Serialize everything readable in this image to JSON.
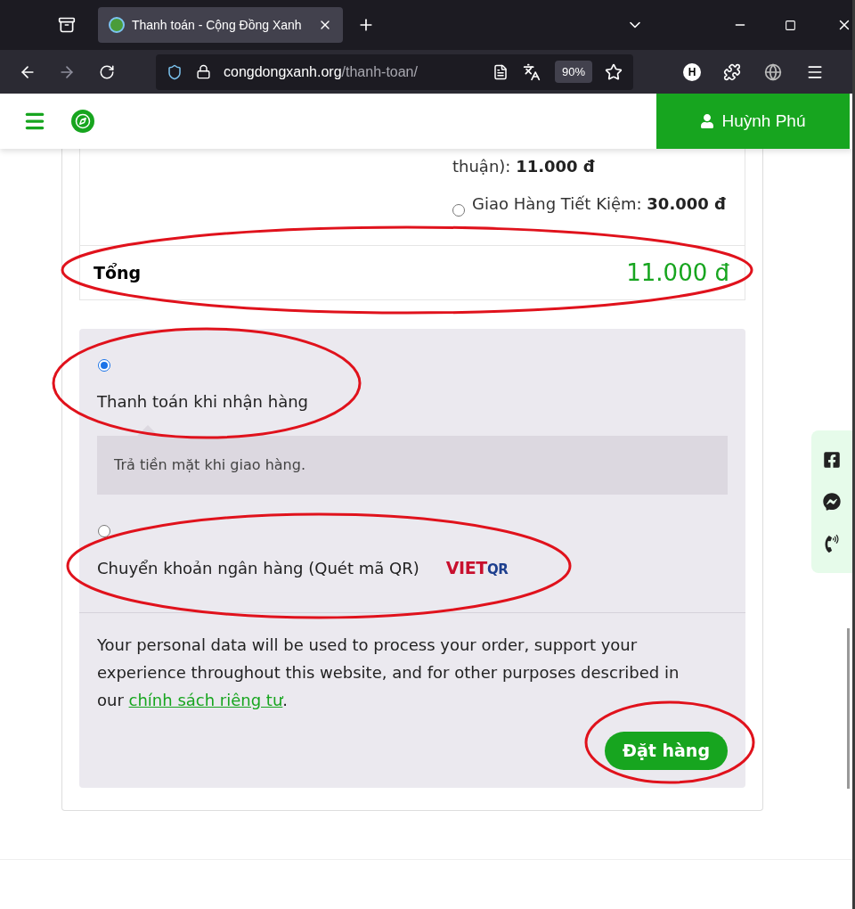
{
  "browser": {
    "tab_title": "Thanh toán - Cộng Đồng Xanh",
    "url_host": "congdongxanh.org",
    "url_path": "/thanh-toan/",
    "zoom": "90%",
    "profile_initial": "H"
  },
  "header": {
    "user_name": "Huỳnh Phú"
  },
  "shipping_options": [
    {
      "label": "thuận):",
      "price": "11.000 đ"
    },
    {
      "label": "Giao Hàng Tiết Kiệm:",
      "price": "30.000 đ",
      "selected": false
    }
  ],
  "total": {
    "label": "Tổng",
    "value": "11.000 đ"
  },
  "payment_methods": [
    {
      "label": "Thanh toán khi nhận hàng",
      "selected": true,
      "description": "Trả tiền mặt khi giao hàng."
    },
    {
      "label": "Chuyển khoản ngân hàng (Quét mã QR)",
      "selected": false,
      "logo": {
        "red": "VIET",
        "blue": "QR"
      }
    }
  ],
  "privacy": {
    "text": "Your personal data will be used to process your order, support your experience throughout this website, and for other purposes described in our",
    "link": "chính sách riêng tư",
    "end": "."
  },
  "order_button": "Đặt hàng"
}
